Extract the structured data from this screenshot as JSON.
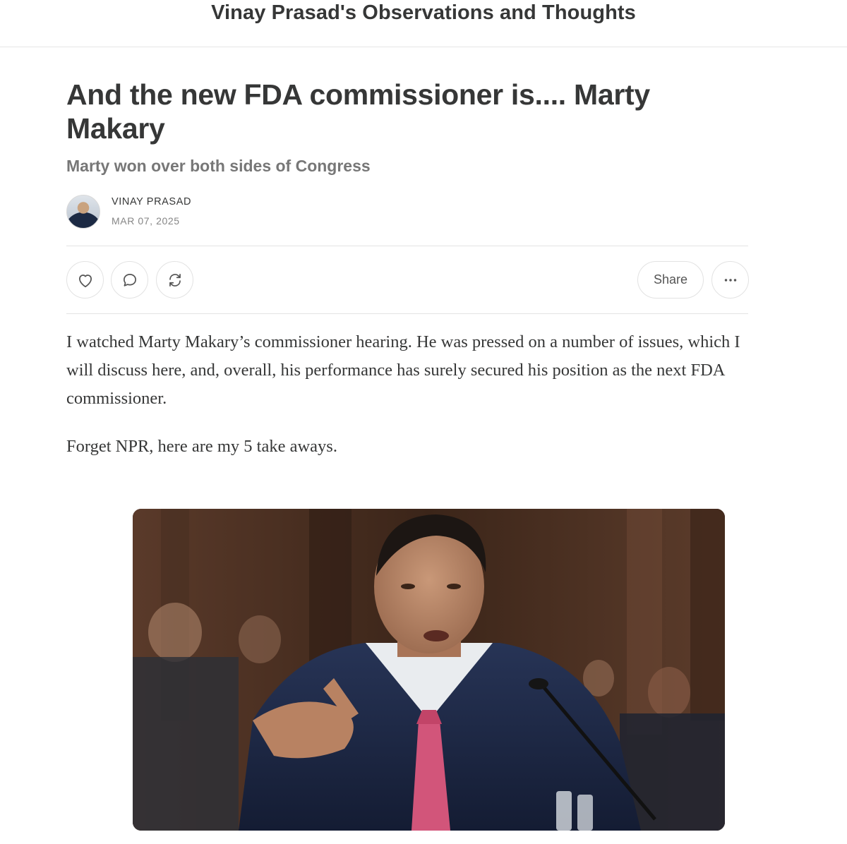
{
  "header": {
    "publication_title": "Vinay Prasad's Observations and Thoughts"
  },
  "post": {
    "title": "And the new FDA commissioner is.... Marty Makary",
    "subtitle": "Marty won over both sides of Congress",
    "author": "VINAY PRASAD",
    "date": "MAR 07, 2025"
  },
  "actions": {
    "like_icon": "heart-icon",
    "comment_icon": "comment-icon",
    "restack_icon": "restack-icon",
    "share_label": "Share",
    "more_icon": "ellipsis-icon"
  },
  "body": {
    "paragraphs": [
      "I watched Marty Makary’s commissioner hearing. He was pressed on a number of issues, which I will discuss here, and, overall, his performance has surely secured his position as the next FDA commissioner.",
      "Forget NPR, here are my 5 take aways."
    ]
  },
  "colors": {
    "text": "#363737",
    "muted": "#777777",
    "border": "#e4e4e4",
    "tie": "#d2557a",
    "suit": "#1f2a48"
  }
}
